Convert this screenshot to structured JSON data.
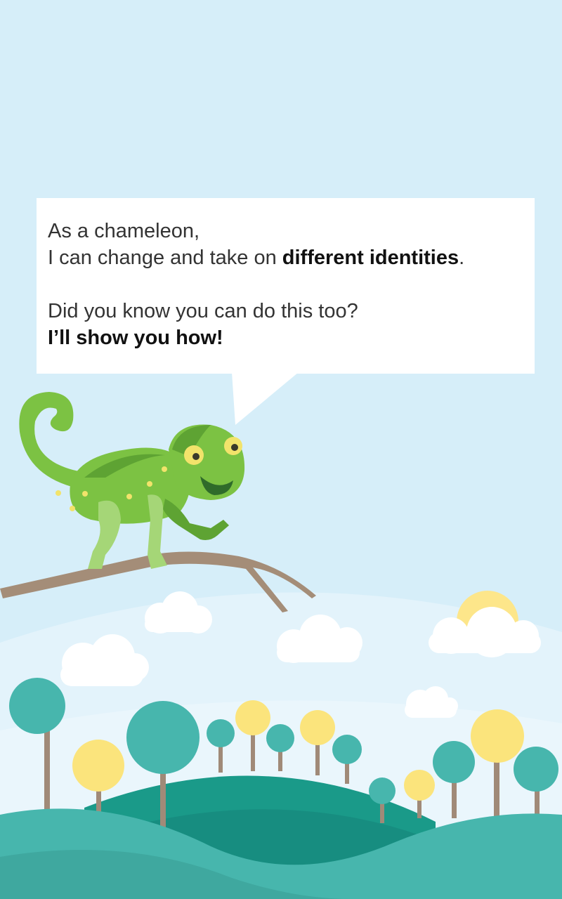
{
  "speech": {
    "line1": "As a chameleon,",
    "line2_prefix": "I can change and take on ",
    "line2_bold": "different identities",
    "line2_suffix": ".",
    "line3": "Did you know you can do this too?",
    "line4": "I’ll show you how!"
  },
  "colors": {
    "sky": "#d6eef9",
    "lower_sky": "#e3f3fb",
    "bubble": "#ffffff",
    "chameleon_green": "#7cc243",
    "chameleon_dark": "#5ea333",
    "chameleon_limb": "#a5d677",
    "spot_yellow": "#f2e36b",
    "branch": "#a48d78",
    "tree_teal": "#47b6ad",
    "tree_yellow": "#fbe47c",
    "trunk": "#a08a78",
    "hill_dark": "#1a9a89",
    "hill_mid": "#47b6ad",
    "cloud": "#ffffff",
    "sun": "#fde68a"
  }
}
